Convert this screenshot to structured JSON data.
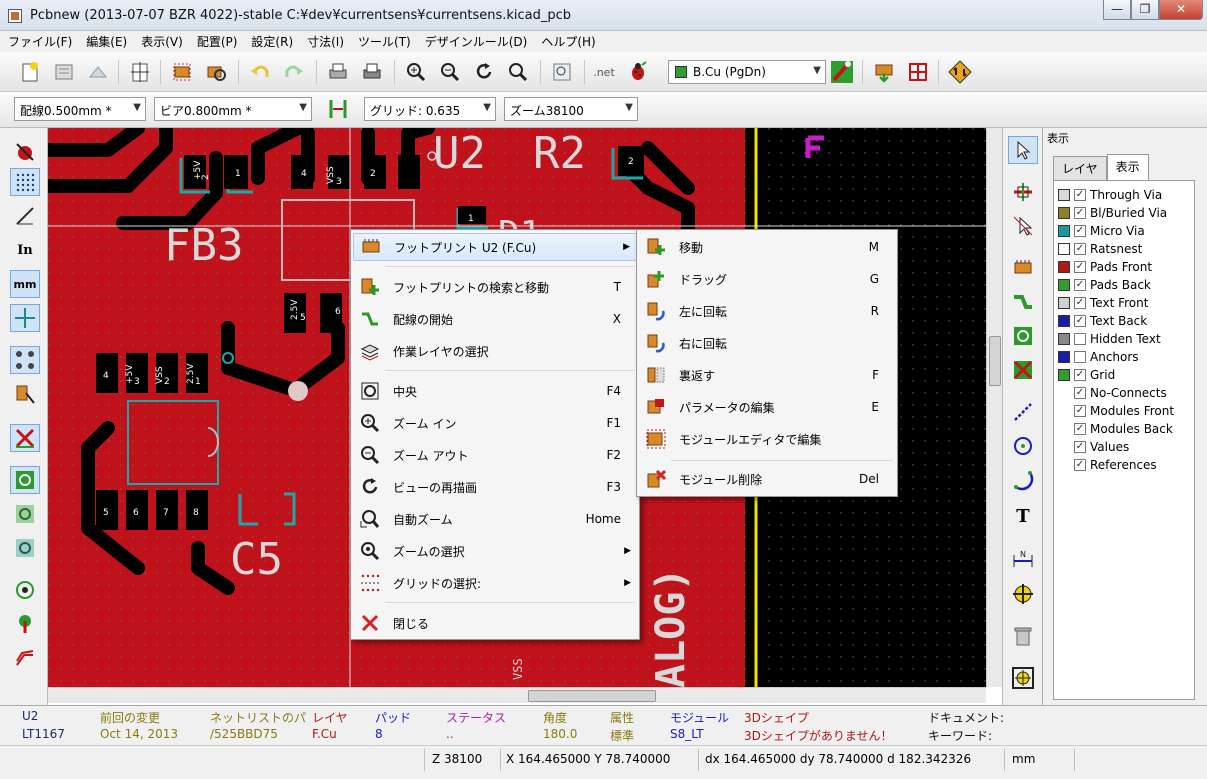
{
  "window": {
    "title": "Pcbnew (2013-07-07 BZR 4022)-stable C:¥dev¥currentsens¥currentsens.kicad_pcb"
  },
  "menubar": [
    "ファイル(F)",
    "編集(E)",
    "表示(V)",
    "配置(P)",
    "設定(R)",
    "寸法(I)",
    "ツール(T)",
    "デザインルール(D)",
    "ヘルプ(H)"
  ],
  "toolbar": {
    "active_layer": "B.Cu (PgDn)",
    "layer_color": "#2f9e2f",
    "net_label": ".net"
  },
  "options_bar": {
    "track_width": "配線0.500mm *",
    "via_size": "ビア0.800mm *",
    "grid": "グリッド: 0.635",
    "zoom": "ズーム38100"
  },
  "canvas": {
    "labels": {
      "u2": "U2",
      "r2": "R2",
      "fb3": "FB3",
      "d1": "D1",
      "c5": "C5",
      "alog": "ALOG)",
      "vss_bottom": "VSS",
      "p5v_a": "+5V",
      "p25v_a": "2.5V",
      "vss_a": "VSS",
      "pin_1a": "1",
      "pin_2a": "2",
      "vss_b": "VSS",
      "pin_4b": "4",
      "pin_2b": "2",
      "pin_3b": "3",
      "p25v_c": "2.5V",
      "pin_5c": "5",
      "pin_6c": "6",
      "pin_4d": "4",
      "p5v_d": "+5V",
      "vss_d": "VSS",
      "p25v_d": "2.5V",
      "pin_1d": "1",
      "pin_2d": "2",
      "pin_3d": "3",
      "pin_5e": "5",
      "pin_6e": "6",
      "pin_7e": "7",
      "pin_8e": "8",
      "pin_1f": "1",
      "pin_2f": "2"
    },
    "board_color": "#c0121b"
  },
  "context_menu": {
    "items": [
      {
        "label": "フットプリント U2 (F.Cu)",
        "key": "",
        "icon": "footprint-icon",
        "submenu": true,
        "highlight": true
      },
      {
        "label": "フットプリントの検索と移動",
        "key": "T",
        "icon": "find-move-icon"
      },
      {
        "label": "配線の開始",
        "key": "X",
        "icon": "track-icon"
      },
      {
        "label": "作業レイヤの選択",
        "key": "",
        "icon": "layers-icon"
      },
      {
        "label": "中央",
        "key": "F4",
        "icon": "center-icon"
      },
      {
        "label": "ズーム イン",
        "key": "F1",
        "icon": "zoom-in-icon"
      },
      {
        "label": "ズーム アウト",
        "key": "F2",
        "icon": "zoom-out-icon"
      },
      {
        "label": "ビューの再描画",
        "key": "F3",
        "icon": "redraw-icon"
      },
      {
        "label": "自動ズーム",
        "key": "Home",
        "icon": "zoom-auto-icon"
      },
      {
        "label": "ズームの選択",
        "key": "",
        "icon": "zoom-select-icon",
        "submenu": true
      },
      {
        "label": "グリッドの選択:",
        "key": "",
        "icon": "grid-icon",
        "submenu": true
      },
      {
        "label": "閉じる",
        "key": "",
        "icon": "close-icon"
      }
    ]
  },
  "submenu": {
    "items": [
      {
        "label": "移動",
        "key": "M",
        "icon": "move-icon"
      },
      {
        "label": "ドラッグ",
        "key": "G",
        "icon": "drag-icon"
      },
      {
        "label": "左に回転",
        "key": "R",
        "icon": "rotate-left-icon"
      },
      {
        "label": "右に回転",
        "key": "",
        "icon": "rotate-right-icon"
      },
      {
        "label": "裏返す",
        "key": "F",
        "icon": "flip-icon"
      },
      {
        "label": "パラメータの編集",
        "key": "E",
        "icon": "edit-params-icon"
      },
      {
        "label": "モジュールエディタで編集",
        "key": "",
        "icon": "module-editor-icon"
      },
      {
        "label": "モジュール削除",
        "key": "Del",
        "icon": "delete-module-icon"
      }
    ]
  },
  "layers_panel": {
    "title": "表示",
    "tabs": [
      "レイヤ",
      "表示"
    ],
    "active_tab": "表示",
    "items": [
      {
        "label": "Through Via",
        "color": "#d9d9d9",
        "checked": true
      },
      {
        "label": "Bl/Buried Via",
        "color": "#8b7f2a",
        "checked": true
      },
      {
        "label": "Micro Via",
        "color": "#1a9a9a",
        "checked": true
      },
      {
        "label": "Ratsnest",
        "color": "#ffffff",
        "checked": true
      },
      {
        "label": "Pads Front",
        "color": "#b01818",
        "checked": true
      },
      {
        "label": "Pads Back",
        "color": "#2f9e2f",
        "checked": true
      },
      {
        "label": "Text Front",
        "color": "#d0d0d0",
        "checked": true
      },
      {
        "label": "Text Back",
        "color": "#1a1aa8",
        "checked": true
      },
      {
        "label": "Hidden Text",
        "color": "#8a8a8a",
        "checked": false
      },
      {
        "label": "Anchors",
        "color": "#1a1aa8",
        "checked": false
      },
      {
        "label": "Grid",
        "color": "#2f9e2f",
        "checked": true
      },
      {
        "label": "No-Connects",
        "checked": true
      },
      {
        "label": "Modules Front",
        "checked": true
      },
      {
        "label": "Modules Back",
        "checked": true
      },
      {
        "label": "Values",
        "checked": true
      },
      {
        "label": "References",
        "checked": true
      }
    ]
  },
  "message_panel": {
    "ref": "U2",
    "value": "LT1167",
    "last_change_label": "前回の変更",
    "last_change": "Oct 14, 2013",
    "netlist_label": "ネットリストのパ",
    "netlist": "/525BBD75",
    "layer_label": "レイヤ",
    "layer": "F.Cu",
    "pads_label": "パッド",
    "pads": "8",
    "status_label": "ステータス",
    "status": "..",
    "orient_label": "角度",
    "orient": "180.0",
    "attr_label": "属性",
    "attr": "標準",
    "module_label": "モジュール",
    "module": "S8_LT",
    "shape3d_label": "3Dシェイプ",
    "shape3d": "3Dシェイプがありません！",
    "doc_label": "ドキュメント:",
    "keyword_label": "キーワード:"
  },
  "statusbar": {
    "zoom": "Z 38100",
    "xy": "X 164.465000  Y 78.740000",
    "dxy": "dx 164.465000  dy 78.740000  d 182.342326",
    "units": "mm"
  }
}
